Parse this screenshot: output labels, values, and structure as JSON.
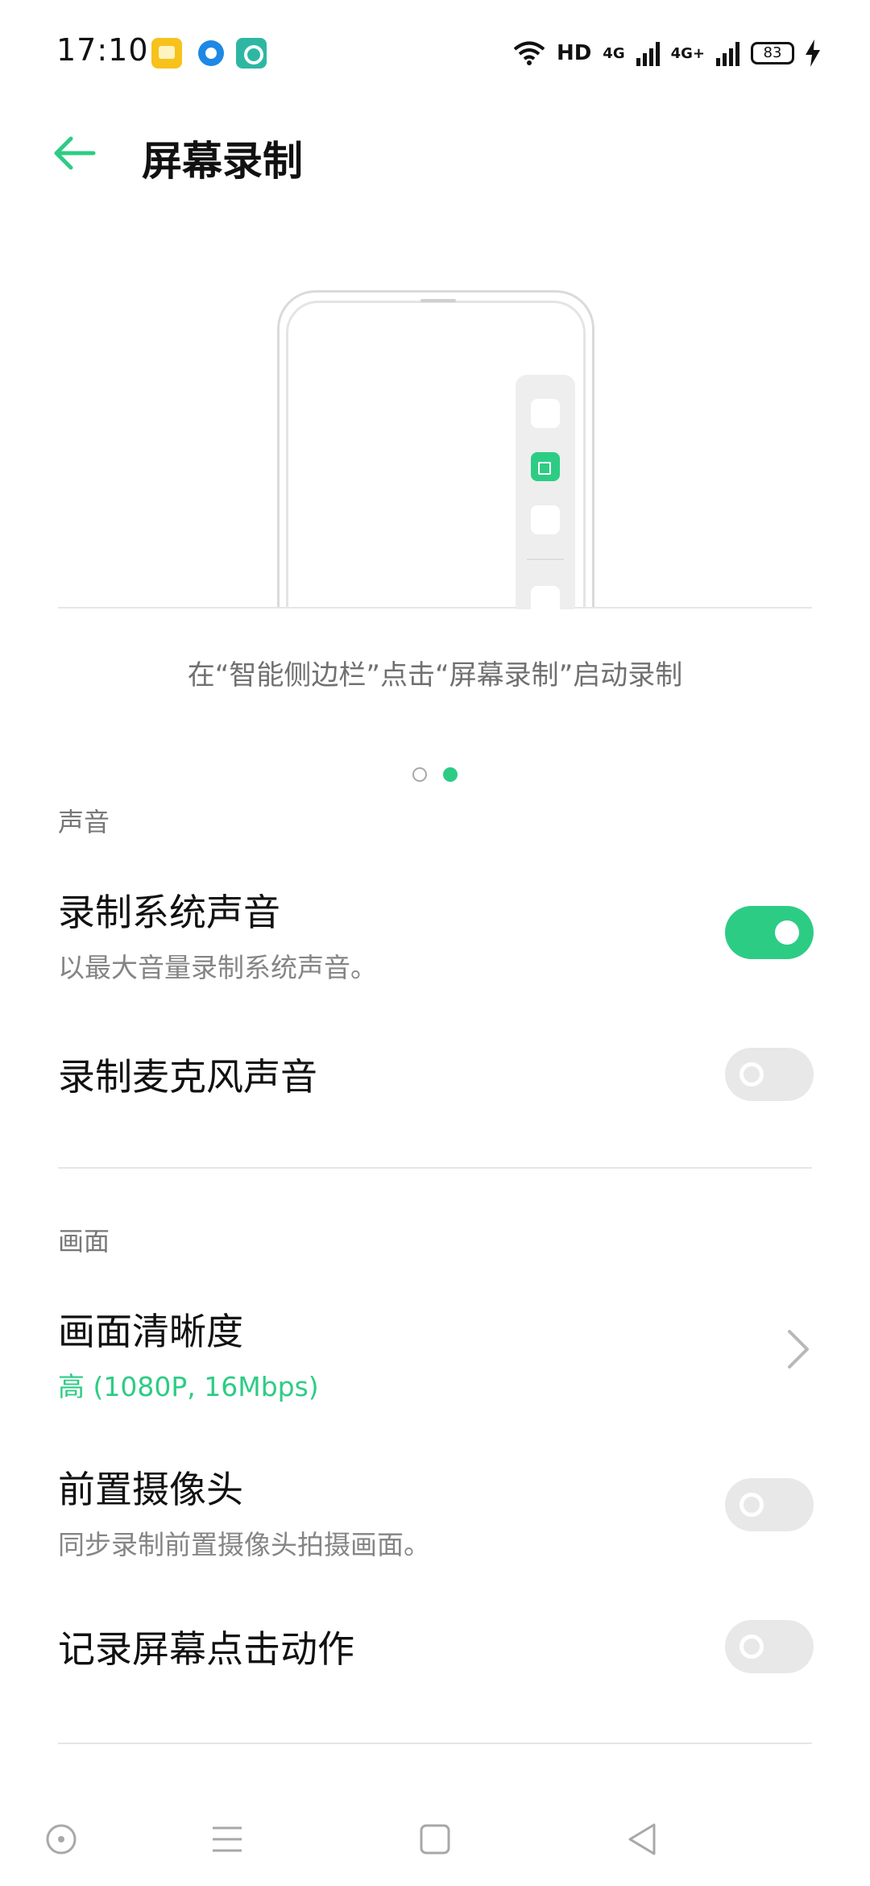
{
  "status_bar": {
    "time": "17:10",
    "notification_icons": [
      "notes-app-icon",
      "browser-app-icon",
      "screen-recorder-app-icon"
    ],
    "hd_label": "HD",
    "network_1": "4G",
    "network_2": "4G+",
    "battery": "83",
    "charging": true
  },
  "app_bar": {
    "title": "屏幕录制",
    "back_icon": "back-arrow-icon"
  },
  "carousel": {
    "caption": "在“智能侧边栏”点击“屏幕录制”启动录制",
    "page_count": 2,
    "active_page": 2
  },
  "sound_section": {
    "header": "声音",
    "record_system_sound": {
      "title": "录制系统声音",
      "subtitle": "以最大音量录制系统声音。",
      "enabled": true
    },
    "record_mic_sound": {
      "title": "录制麦克风声音",
      "enabled": false
    }
  },
  "picture_section": {
    "header": "画面",
    "resolution": {
      "title": "画面清晰度",
      "value": "高 (1080P, 16Mbps)"
    },
    "front_camera": {
      "title": "前置摄像头",
      "subtitle": "同步录制前置摄像头拍摄画面。",
      "enabled": false
    },
    "record_touches": {
      "title": "记录屏幕点击动作",
      "enabled": false
    }
  },
  "nav_bar": {
    "buttons": [
      "assistant-icon",
      "menu-icon",
      "home-icon",
      "back-triangle-icon"
    ]
  },
  "colors": {
    "accent": "#2dcc84",
    "toggle_off": "#e8e8e8",
    "divider": "#e6e6e6"
  }
}
